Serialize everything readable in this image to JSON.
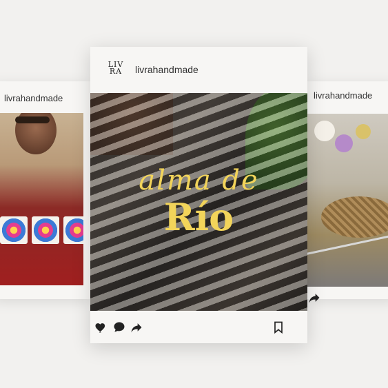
{
  "posts": [
    {
      "id": "left",
      "username": "livrahandmade"
    },
    {
      "id": "main",
      "username": "livrahandmade",
      "logo_text": "LIV\nRA",
      "overlay_script": "alma de",
      "overlay_title": "Río"
    },
    {
      "id": "right",
      "username": "livrahandmade"
    }
  ],
  "icons": {
    "like": "heart-icon",
    "comment": "comment-icon",
    "share": "share-icon",
    "save": "bookmark-icon"
  },
  "colors": {
    "accent_text": "#f2d45a",
    "icon": "#222222",
    "card": "#f7f6f4"
  }
}
